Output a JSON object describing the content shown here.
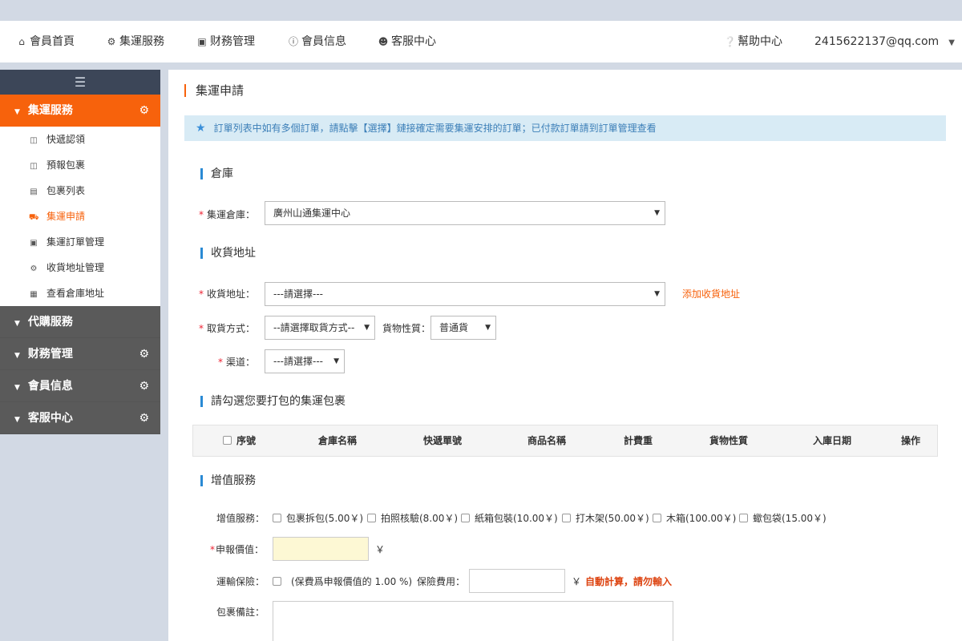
{
  "topnav": {
    "items": [
      {
        "icon": "home-icon",
        "label": "會員首頁"
      },
      {
        "icon": "gear-icon",
        "label": "集運服務"
      },
      {
        "icon": "money-icon",
        "label": "财務管理"
      },
      {
        "icon": "info-icon",
        "label": "會員信息"
      },
      {
        "icon": "user-icon",
        "label": "客服中心"
      }
    ],
    "help_label": "幫助中心",
    "account": "2415622137@qq.com"
  },
  "sidebar": {
    "toggle_icon": "menu-icon",
    "groups": [
      {
        "label": "集運服務",
        "expanded": true,
        "has_gear": true
      },
      {
        "label": "代購服務",
        "expanded": false,
        "has_gear": false
      },
      {
        "label": "财務管理",
        "expanded": false,
        "has_gear": true
      },
      {
        "label": "會員信息",
        "expanded": false,
        "has_gear": true
      },
      {
        "label": "客服中心",
        "expanded": false,
        "has_gear": true
      }
    ],
    "items": [
      {
        "icon": "inbox-icon",
        "label": "快遞認領"
      },
      {
        "icon": "tray-icon",
        "label": "預報包裹"
      },
      {
        "icon": "list-icon",
        "label": "包裹列表"
      },
      {
        "icon": "truck-icon",
        "label": "集運申請",
        "active": true
      },
      {
        "icon": "book-icon",
        "label": "集運訂單管理"
      },
      {
        "icon": "cogs-icon",
        "label": "收貨地址管理"
      },
      {
        "icon": "building-icon",
        "label": "查看倉庫地址"
      }
    ],
    "accent_color": "#f7620c"
  },
  "main": {
    "title": "集運申請",
    "notice": "訂單列表中如有多個訂單，請點擊【選擇】鏈接確定需要集運安排的訂單；已付款訂單請到訂單管理查看",
    "sections": {
      "warehouse": "倉庫",
      "address": "收貨地址",
      "packages": "請勾選您要打包的集運包裹",
      "value_added": "增值服務"
    },
    "warehouse_label": "集運倉庫：",
    "warehouse_value": "廣州山通集運中心",
    "address_label": "收貨地址：",
    "address_value": "---請選擇---",
    "add_address_link": "添加收貨地址",
    "pickup_label": "取貨方式：",
    "pickup_value": "--請選擇取貨方式--",
    "goods_type_label": "貨物性質：",
    "goods_type_value": "普通貨",
    "channel_label": "渠道：",
    "channel_value": "---請選擇---",
    "table_headers": [
      "序號",
      "倉庫名稱",
      "快遞單號",
      "商品名稱",
      "計費重",
      "貨物性質",
      "入庫日期",
      "操作"
    ],
    "services_label": "增值服務：",
    "services": [
      "包裹拆包(5.00￥)",
      "拍照核驗(8.00￥)",
      "紙箱包裝(10.00￥)",
      "打木架(50.00￥)",
      "木箱(100.00￥)",
      "蠍包袋(15.00￥)"
    ],
    "declared_label": "申報價值：",
    "currency": "￥",
    "insurance_label": "運輸保險：",
    "insurance_note": "(保費爲申報價值的 1.00 %)",
    "insurance_fee_label": "保險費用：",
    "auto_calc_note": "自動計算，請勿輸入",
    "remark_label": "包裹備註："
  }
}
